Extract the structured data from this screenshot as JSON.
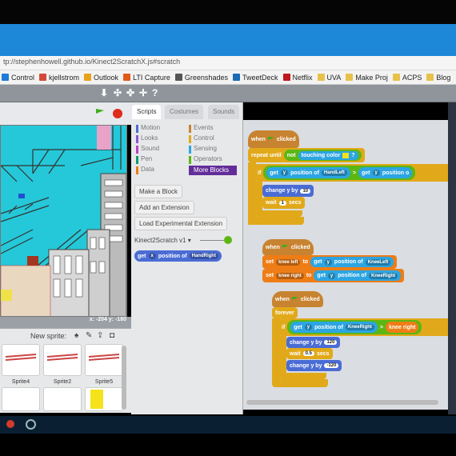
{
  "browser": {
    "url": "tp://stephenhowell.github.io/Kinect2ScratchX.js#scratch",
    "bookmarks": [
      {
        "label": "Control",
        "color": "#1e7bd8"
      },
      {
        "label": "kjellstrom",
        "color": "#d44a3a"
      },
      {
        "label": "Outlook",
        "color": "#e8a21a"
      },
      {
        "label": "LTI Capture",
        "color": "#e05a1a"
      },
      {
        "label": "Greenshades",
        "color": "#555555"
      },
      {
        "label": "TweetDeck",
        "color": "#1a6ab4"
      },
      {
        "label": "Netflix",
        "color": "#c0171a"
      },
      {
        "label": "UVA",
        "color": "#e8c14a"
      },
      {
        "label": "Make Proj",
        "color": "#e8c14a"
      },
      {
        "label": "ACPS",
        "color": "#e8c14a"
      },
      {
        "label": "Blog",
        "color": "#e8c14a"
      }
    ]
  },
  "stage": {
    "coords": "x: -204   y: -180",
    "new_sprite_label": "New sprite:"
  },
  "sprites": [
    "Sprite4",
    "Sprite2",
    "Sprite5"
  ],
  "tabs": {
    "scripts": "Scripts",
    "costumes": "Costumes",
    "sounds": "Sounds"
  },
  "categories": {
    "left": [
      "Motion",
      "Looks",
      "Sound",
      "Pen",
      "Data"
    ],
    "right": [
      "Events",
      "Control",
      "Sensing",
      "Operators"
    ],
    "more_blocks": "More Blocks"
  },
  "palette": {
    "make_block": "Make a Block",
    "add_extension": "Add an Extension",
    "load_experimental": "Load Experimental Extension",
    "extension_name": "Kinect2Scratch v1 ▾",
    "reporter": {
      "a": "get",
      "b": "x",
      "c": "position of",
      "d": "HandRight"
    }
  },
  "script1": {
    "hat": "when",
    "hat2": "clicked",
    "repeat": "repeat until",
    "not": "not",
    "touching": "touching color",
    "q": "?",
    "if": "if",
    "get1": "get",
    "y1": "y",
    "pos1": "position of",
    "part1": "HandLeft",
    "gt": ">",
    "get2": "get",
    "y2": "y",
    "pos2": "position o",
    "change": "change y by",
    "change_val": "10",
    "wait": "wait",
    "wait_val": "1",
    "secs": "secs"
  },
  "script2": {
    "hat": "when",
    "hat2": "clicked",
    "set1": "set",
    "var1": "knee left",
    "to1": "to",
    "get_a": "get",
    "y_a": "y",
    "pos_a": "position of",
    "part_a": "KneeLeft",
    "set2": "set",
    "var2": "knee right",
    "to2": "to",
    "get_b": "get",
    "y_b": "y",
    "pos_b": "position of",
    "part_b": "KneeRight"
  },
  "script3": {
    "hat": "when",
    "hat2": "clicked",
    "forever": "forever",
    "if": "if",
    "get": "get",
    "y": "y",
    "pos": "position of",
    "part": "KneeRight",
    "gt": ">",
    "var": "knee right",
    "change1": "change y by",
    "change1_val": "120",
    "wait": "wait",
    "wait_val": "0.5",
    "secs": "secs",
    "change2": "change y by",
    "change2_val": "-120"
  },
  "colors": {
    "accent": "#1e88d8",
    "events": "#c88330",
    "control": "#e1a91a",
    "sensing": "#2ca5e2",
    "operators": "#5cb712",
    "data": "#ee7d16",
    "more_blocks": "#632d99"
  }
}
